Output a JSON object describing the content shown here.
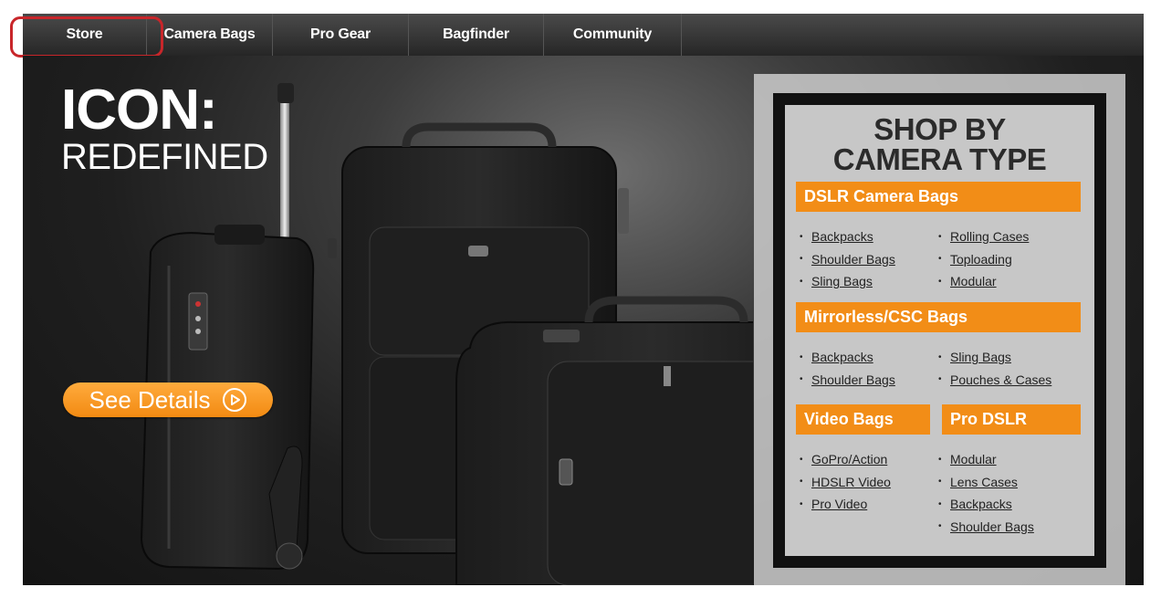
{
  "nav": {
    "items": [
      "Store",
      "Camera Bags",
      "Pro Gear",
      "Bagfinder",
      "Community"
    ]
  },
  "hero": {
    "title_line1": "ICON:",
    "title_line2": "REDEFINED",
    "cta_label": "See Details",
    "cta_icon": "play-circle-icon"
  },
  "shop": {
    "title_line1": "SHOP BY",
    "title_line2": "CAMERA TYPE",
    "dslr": {
      "label": "DSLR Camera Bags",
      "left": [
        "Backpacks",
        "Shoulder Bags",
        "Sling Bags"
      ],
      "right": [
        "Rolling Cases",
        "Toploading",
        "Modular"
      ]
    },
    "mirrorless": {
      "label": "Mirrorless/CSC Bags",
      "left": [
        "Backpacks",
        "Shoulder Bags"
      ],
      "right": [
        "Sling Bags",
        "Pouches & Cases"
      ]
    },
    "video": {
      "label": "Video Bags",
      "items": [
        "GoPro/Action",
        "HDSLR Video",
        "Pro Video"
      ]
    },
    "prodslr": {
      "label": "Pro DSLR",
      "items": [
        "Modular",
        "Lens Cases",
        "Backpacks",
        "Shoulder Bags"
      ]
    }
  },
  "colors": {
    "accent_orange": "#f28d17",
    "highlight_red": "#c8262a"
  }
}
